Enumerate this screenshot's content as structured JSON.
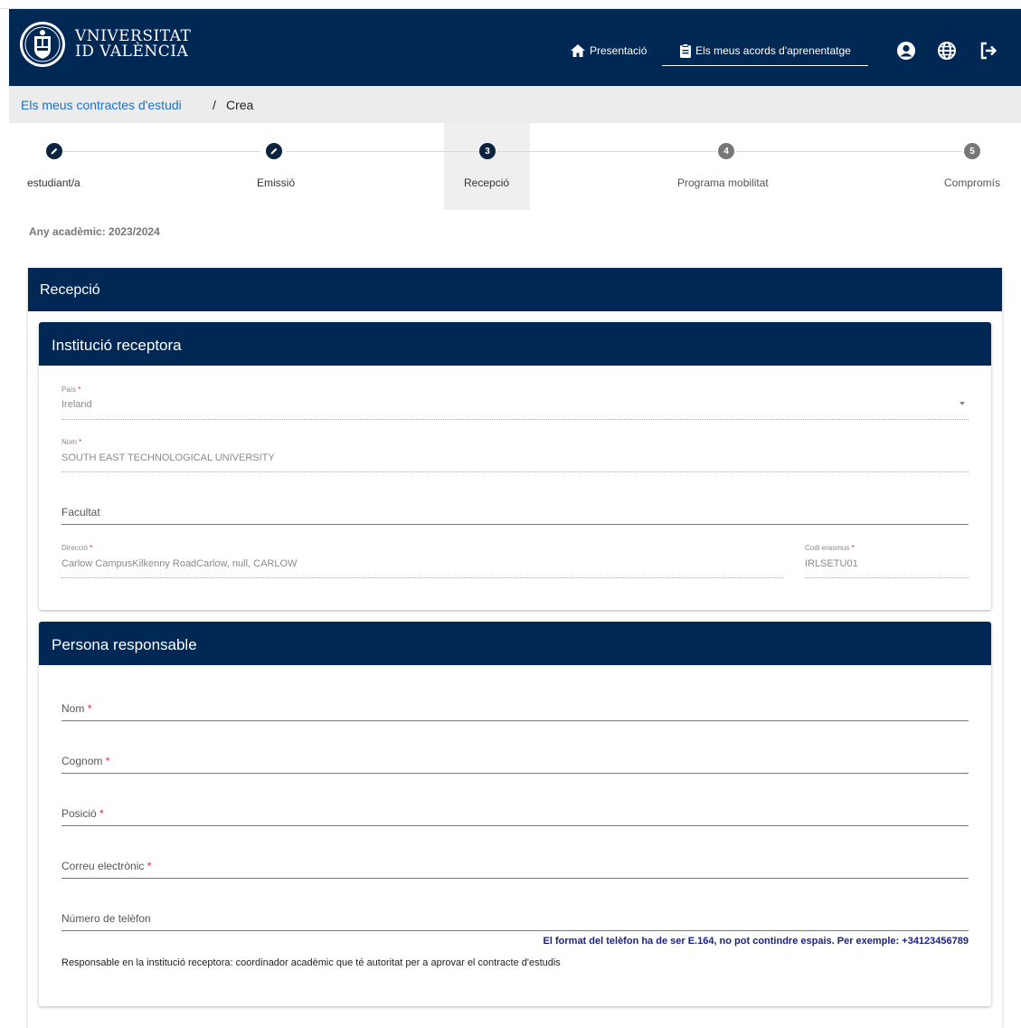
{
  "header": {
    "logo_line1": "VNIVERSITAT",
    "logo_line2": "ID VALÈNCIA",
    "nav_presentacio": "Presentació",
    "nav_acords": "Els meus acords d'aprenentatge",
    "icons": [
      "home-icon",
      "clipboard-icon",
      "user-icon",
      "globe-icon",
      "logout-icon"
    ]
  },
  "breadcrumb": {
    "link": "Els meus contractes d'estudi",
    "separator": "/",
    "current": "Crea"
  },
  "stepper": {
    "steps": [
      {
        "label": "estudiant/a",
        "state": "done",
        "number": ""
      },
      {
        "label": "Emissió",
        "state": "done",
        "number": ""
      },
      {
        "label": "Recepció",
        "state": "active",
        "number": "3"
      },
      {
        "label": "Programa mobilitat",
        "state": "todo",
        "number": "4"
      },
      {
        "label": "Compromís",
        "state": "todo",
        "number": "5"
      }
    ]
  },
  "any_academic": "Any acadèmic: 2023/2024",
  "recepcio": {
    "title": "Recepció",
    "institucio": {
      "title": "Institució receptora",
      "pais": {
        "label": "País",
        "required": "*",
        "value": "Ireland"
      },
      "nom": {
        "label": "Nom",
        "required": "*",
        "value": "SOUTH EAST TECHNOLOGICAL UNIVERSITY"
      },
      "facultat": {
        "placeholder": "Facultat",
        "value": ""
      },
      "direccio": {
        "label": "Direcció",
        "required": "*",
        "value": "Carlow CampusKilkenny RoadCarlow, null, CARLOW"
      },
      "codi": {
        "label": "Codi erasmus",
        "required": "*",
        "value": "IRLSETU01"
      }
    },
    "persona": {
      "title": "Persona responsable",
      "nom": {
        "placeholder": "Nom",
        "required": "*"
      },
      "cognom": {
        "placeholder": "Cognom",
        "required": "*"
      },
      "posicio": {
        "placeholder": "Posició",
        "required": "*"
      },
      "correu": {
        "placeholder": "Correu electrònic",
        "required": "*"
      },
      "telefon": {
        "placeholder": "Número de telèfon"
      },
      "hint": "El format del telèfon ha de ser E.164, no pot contindre espais. Per exemple: +34123456789",
      "note": "Responsable en la institució receptora: coordinador acadèmic que té autoritat per a aprovar el contracte d'estudis"
    }
  },
  "colors": {
    "primary": "#002855",
    "link": "#1e70c9",
    "required": "#e0245e",
    "hint": "#1a237e"
  }
}
